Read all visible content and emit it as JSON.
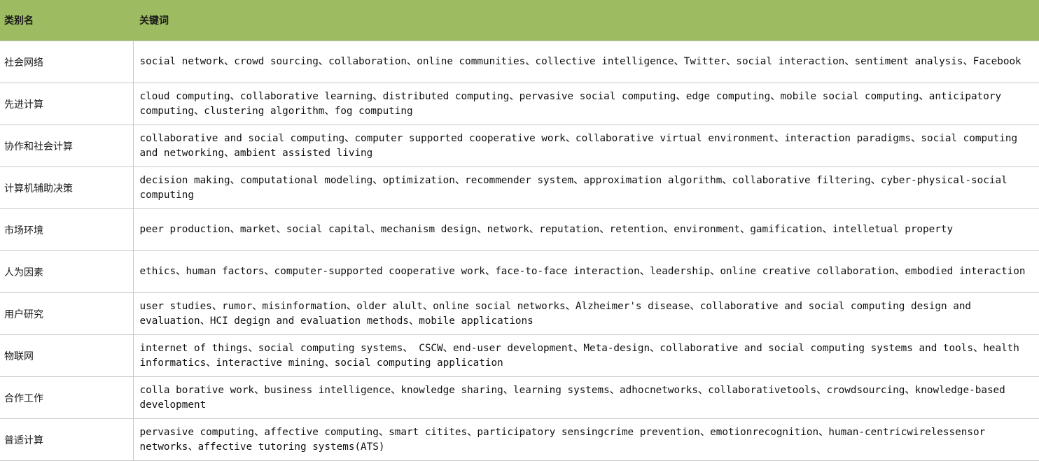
{
  "table": {
    "headers": {
      "category": "类别名",
      "keywords": "关键词"
    },
    "header_bg": "#9DBB60",
    "border_color": "#c8c8c8",
    "rows": [
      {
        "category": "社会网络",
        "keywords": "social network、crowd sourcing、collaboration、online communities、collective intelligence、Twitter、social interaction、sentiment analysis、Facebook"
      },
      {
        "category": "先进计算",
        "keywords": "cloud computing、collaborative learning、distributed computing、pervasive social computing、edge computing、mobile social computing、anticipatory computing、clustering algorithm、fog computing"
      },
      {
        "category": "协作和社会计算",
        "keywords": "collaborative and social computing、computer supported cooperative work、collaborative virtual environment、interaction paradigms、social computing and networking、ambient assisted living"
      },
      {
        "category": "计算机辅助决策",
        "keywords": "decision making、computational modeling、optimization、recommender system、approximation algorithm、collaborative filtering、cyber-physical-social computing"
      },
      {
        "category": "市场环境",
        "keywords": "peer production、market、social capital、mechanism design、network、reputation、retention、environment、gamification、intelletual property"
      },
      {
        "category": "人为因素",
        "keywords": "ethics、human factors、computer-supported cooperative work、face-to-face interaction、leadership、online creative collaboration、embodied interaction"
      },
      {
        "category": "用户研究",
        "keywords": "user studies、rumor、misinformation、older alult、online social networks、Alzheimer's disease、collaborative and social computing design and evaluation、HCI degign and evaluation methods、mobile applications"
      },
      {
        "category": "物联网",
        "keywords": "internet of things、social computing systems、 CSCW、end-user development、Meta-design、collaborative and social computing systems and tools、health informatics、interactive mining、social computing application"
      },
      {
        "category": "合作工作",
        "keywords": "colla borative work、business intelligence、knowledge sharing、learning systems、adhocnetworks、collaborativetools、crowdsourcing、knowledge-based development"
      },
      {
        "category": "普适计算",
        "keywords": "pervasive computing、affective computing、smart citites、participatory sensingcrime prevention、emotionrecognition、human-centricwirelessensor networks、affective tutoring systems(ATS)"
      }
    ]
  }
}
